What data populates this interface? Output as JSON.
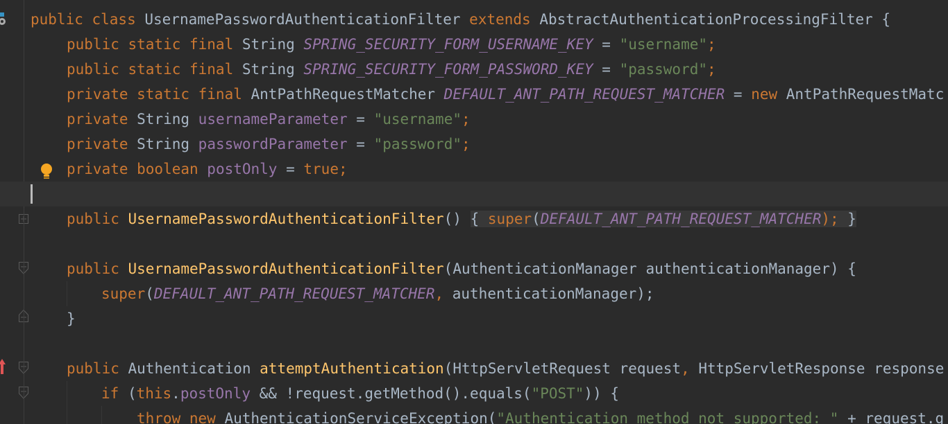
{
  "colors": {
    "background": "#2b2b2b",
    "keyword": "#cc7832",
    "field": "#9876aa",
    "string": "#6a8759",
    "method_declaration": "#ffc66d",
    "plain": "#a9b7c6"
  },
  "gutter": {
    "icons": [
      "class-icon",
      "lightbulb-icon",
      "fold-expand-icon",
      "fold-collapse-icon",
      "fold-end-icon",
      "override-arrow-icon",
      "fold-collapse-icon"
    ]
  },
  "code": {
    "line1": {
      "t1": "public class ",
      "t2": "UsernamePasswordAuthenticationFilter ",
      "t3": "extends ",
      "t4": "AbstractAuthenticationProcessingFilter {"
    },
    "line2": {
      "t1": "public static final ",
      "t2": "String ",
      "t3": "SPRING_SECURITY_FORM_USERNAME_KEY",
      "t4": " = ",
      "t5": "\"username\"",
      "t6": ";"
    },
    "line3": {
      "t1": "public static final ",
      "t2": "String ",
      "t3": "SPRING_SECURITY_FORM_PASSWORD_KEY",
      "t4": " = ",
      "t5": "\"password\"",
      "t6": ";"
    },
    "line4": {
      "t1": "private static final ",
      "t2": "AntPathRequestMatcher ",
      "t3": "DEFAULT_ANT_PATH_REQUEST_MATCHER",
      "t4": " = ",
      "t5": "new ",
      "t6": "AntPathRequestMatc"
    },
    "line5": {
      "t1": "private ",
      "t2": "String ",
      "t3": "usernameParameter",
      "t4": " = ",
      "t5": "\"username\"",
      "t6": ";"
    },
    "line6": {
      "t1": "private ",
      "t2": "String ",
      "t3": "passwordParameter",
      "t4": " = ",
      "t5": "\"password\"",
      "t6": ";"
    },
    "line7": {
      "t1": "private boolean ",
      "t2": "postOnly",
      "t3": " = ",
      "t4": "true",
      "t5": ";"
    },
    "line9": {
      "t1": "public ",
      "t2": "UsernamePasswordAuthenticationFilter",
      "t3": "() ",
      "t4": "{ ",
      "t5": "super",
      "t6": "(",
      "t7": "DEFAULT_ANT_PATH_REQUEST_MATCHER",
      "t8": ");",
      "t9": " }"
    },
    "line11": {
      "t1": "public ",
      "t2": "UsernamePasswordAuthenticationFilter",
      "t3": "(AuthenticationManager authenticationManager) {"
    },
    "line12": {
      "t1": "super",
      "t2": "(",
      "t3": "DEFAULT_ANT_PATH_REQUEST_MATCHER",
      "t4": ", ",
      "t5": "authenticationManager);"
    },
    "line13": {
      "t1": "}"
    },
    "line15": {
      "t1": "public ",
      "t2": "Authentication ",
      "t3": "attemptAuthentication",
      "t4": "(HttpServletRequest request",
      "t5": ", ",
      "t6": "HttpServletResponse response"
    },
    "line16": {
      "t1": "if ",
      "t2": "(",
      "t3": "this",
      "t4": ".",
      "t5": "postOnly",
      "t6": " && !request.getMethod().equals(",
      "t7": "\"POST\"",
      "t8": ")) {"
    },
    "line17": {
      "t1": "throw new ",
      "t2": "AuthenticationServiceException(",
      "t3": "\"Authentication method not supported: \"",
      "t4": " + request.g"
    }
  }
}
